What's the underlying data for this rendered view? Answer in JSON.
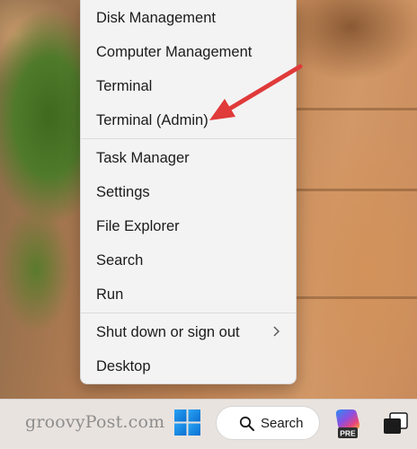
{
  "menu": {
    "items": [
      {
        "label": "Disk Management"
      },
      {
        "label": "Computer Management"
      },
      {
        "label": "Terminal"
      },
      {
        "label": "Terminal (Admin)"
      },
      {
        "label": "Task Manager"
      },
      {
        "label": "Settings"
      },
      {
        "label": "File Explorer"
      },
      {
        "label": "Search"
      },
      {
        "label": "Run"
      },
      {
        "label": "Shut down or sign out"
      },
      {
        "label": "Desktop"
      }
    ]
  },
  "annotation": {
    "arrow_color": "#e03a3a"
  },
  "taskbar": {
    "watermark": "groovyPost.com",
    "search_label": "Search",
    "copilot_badge": "PRE",
    "icons": [
      "windows-start-icon",
      "search-icon",
      "copilot-icon",
      "task-view-icon"
    ]
  }
}
